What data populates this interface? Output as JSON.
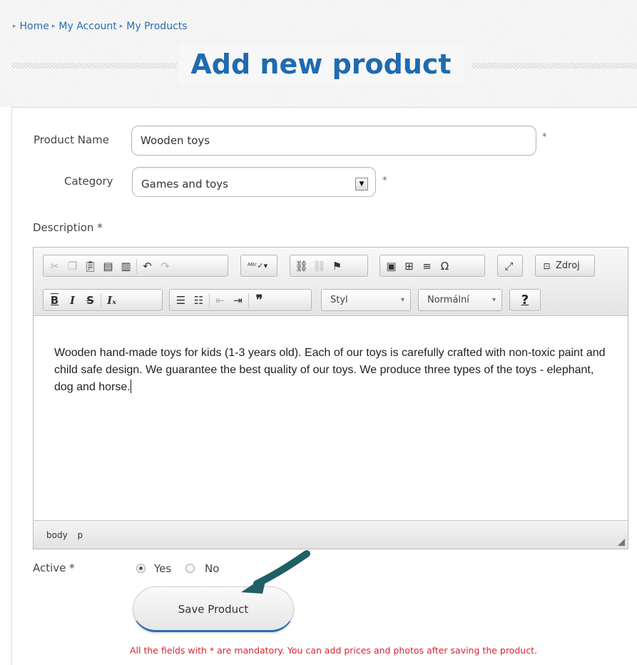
{
  "breadcrumb": [
    {
      "label": "Home"
    },
    {
      "label": "My Account"
    },
    {
      "label": "My Products"
    }
  ],
  "page": {
    "title": "Add new product"
  },
  "form": {
    "product_name_label": "Product Name",
    "product_name_value": "Wooden toys",
    "category_label": "Category",
    "category_value": "Games and toys",
    "required_marker": "*",
    "description_label": "Description *",
    "active_label": "Active *",
    "active_yes": "Yes",
    "active_no": "No",
    "active_selected": "Yes",
    "save_label": "Save Product",
    "mandatory_note": "All the fields with * are mandatory. You can add prices and photos after saving the product."
  },
  "editor": {
    "toolbar": {
      "source_label": "Zdroj",
      "style_combo": "Styl",
      "format_combo": "Normální",
      "help_label": "?",
      "icons": [
        "cut-icon",
        "copy-icon",
        "paste-icon",
        "paste-text-icon",
        "paste-word-icon",
        "undo-icon",
        "redo-icon",
        "spellcheck-icon",
        "link-icon",
        "unlink-icon",
        "anchor-icon",
        "image-icon",
        "table-icon",
        "horizontal-rule-icon",
        "special-char-icon",
        "maximize-icon",
        "source-icon",
        "bold-icon",
        "italic-icon",
        "strike-icon",
        "remove-format-icon",
        "numbered-list-icon",
        "bulleted-list-icon",
        "outdent-icon",
        "indent-icon",
        "blockquote-icon"
      ]
    },
    "content": "Wooden hand-made toys for kids (1-3 years old). Each of our toys is carefully crafted with non-toxic paint and child safe design. We guarantee the best quality of our toys. We produce three types of the toys - elephant, dog and horse.",
    "status_path": [
      "body",
      "p"
    ]
  },
  "colors": {
    "title": "#1f6bb0",
    "link": "#2a6db2",
    "note": "#d9232e",
    "arrow": "#1f5f66"
  }
}
